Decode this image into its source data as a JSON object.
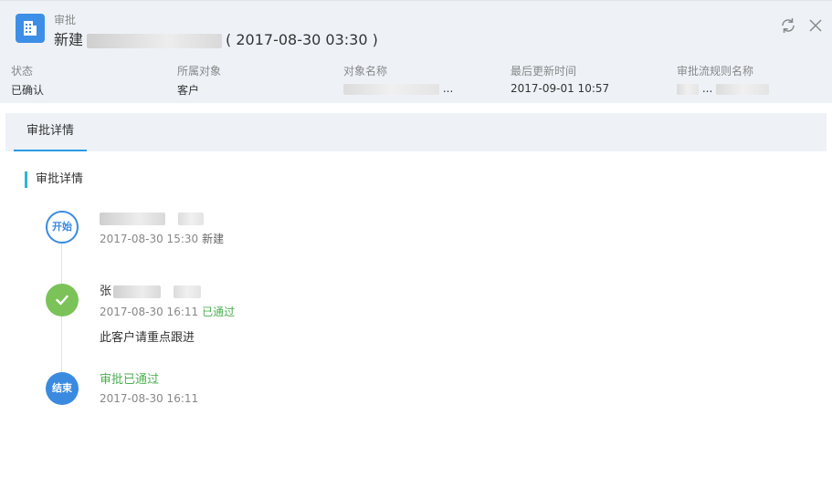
{
  "header": {
    "module_label": "审批",
    "title_prefix": "新建",
    "title_date": "( 2017-08-30 03:30 )",
    "actions": {
      "refresh_icon": "refresh-icon",
      "close_icon": "close-icon"
    }
  },
  "fields": [
    {
      "label": "状态",
      "value": "已确认"
    },
    {
      "label": "所属对象",
      "value": "客户"
    },
    {
      "label": "对象名称",
      "value": "..."
    },
    {
      "label": "最后更新时间",
      "value": "2017-09-01 10:57"
    },
    {
      "label": "审批流规则名称",
      "value": "..."
    }
  ],
  "tabs": [
    {
      "label": "审批详情",
      "active": true
    }
  ],
  "section_title": "审批详情",
  "timeline": {
    "start": {
      "badge": "开始",
      "name": "",
      "time": "2017-08-30 15:30",
      "action": "新建"
    },
    "approved": {
      "name_prefix": "张",
      "time": "2017-08-30 16:11",
      "action": "已通过",
      "comment": "此客户请重点跟进"
    },
    "end": {
      "badge": "结束",
      "status": "审批已通过",
      "time": "2017-08-30 16:11"
    }
  },
  "colors": {
    "accent_blue": "#3a8ae0",
    "success_green": "#7bc359",
    "section_bar": "#29b6d2",
    "header_bg": "#eef2f7"
  }
}
